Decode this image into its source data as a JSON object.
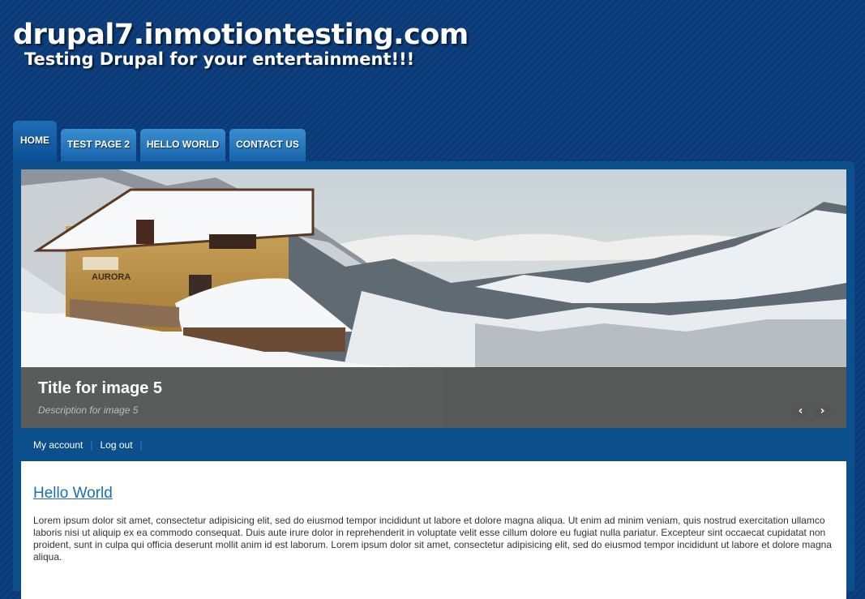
{
  "site": {
    "name": "drupal7.inmotiontesting.com",
    "slogan": "Testing Drupal for your entertainment!!!"
  },
  "nav": {
    "tabs": [
      {
        "label": "HOME",
        "active": true
      },
      {
        "label": "TEST PAGE 2",
        "active": false
      },
      {
        "label": "HELLO WORLD",
        "active": false
      },
      {
        "label": "CONTACT US",
        "active": false
      }
    ]
  },
  "slideshow": {
    "title": "Title for image 5",
    "description": "Description for image 5",
    "prev_icon": "‹",
    "next_icon": "›",
    "house_sign": "AURORA"
  },
  "user_menu": {
    "my_account": "My account",
    "log_out": "Log out"
  },
  "article": {
    "title": "Hello World",
    "body": "Lorem ipsum dolor sit amet, consectetur adipisicing elit, sed do eiusmod tempor incididunt ut labore et dolore magna aliqua. Ut enim ad minim veniam, quis nostrud exercitation ullamco laboris nisi ut aliquip ex ea commodo consequat. Duis aute irure dolor in reprehenderit in voluptate velit esse cillum dolore eu fugiat nulla pariatur. Excepteur sint occaecat cupidatat non proident, sunt in culpa qui officia deserunt mollit anim id est laborum. Lorem ipsum dolor sit amet, consectetur adipisicing elit, sed do eiusmod tempor incididunt ut labore et dolore magna aliqua."
  },
  "colors": {
    "background": "#0a3a78",
    "panel": "#0c4f8d",
    "tab": "#1f6cb5",
    "link": "#1b6fb5"
  }
}
